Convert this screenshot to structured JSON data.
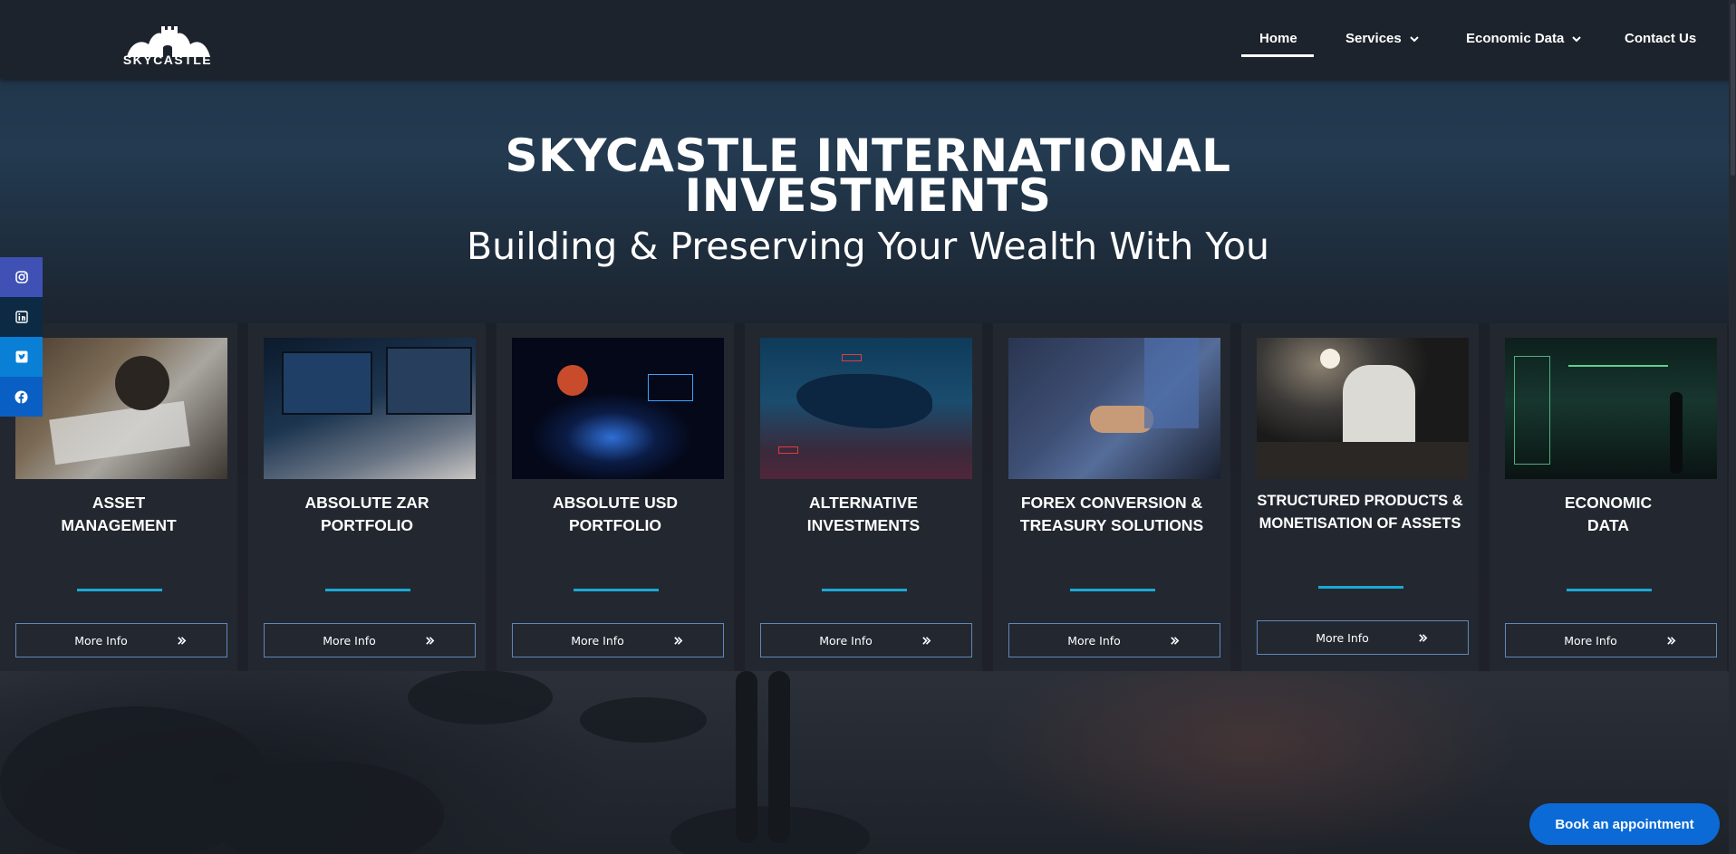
{
  "brand": {
    "name": "SKYCASTLE",
    "logo_icon": "castle-icon"
  },
  "nav": {
    "items": [
      {
        "label": "Home",
        "active": true,
        "has_dropdown": false
      },
      {
        "label": "Services",
        "active": false,
        "has_dropdown": true
      },
      {
        "label": "Economic Data",
        "active": false,
        "has_dropdown": true
      },
      {
        "label": "Contact Us",
        "active": false,
        "has_dropdown": false
      }
    ]
  },
  "hero": {
    "title": "SKYCASTLE INTERNATIONAL INVESTMENTS",
    "subtitle": "Building & Preserving Your Wealth With You"
  },
  "social": [
    {
      "icon": "instagram-icon",
      "color": "#3f51b5"
    },
    {
      "icon": "linkedin-icon",
      "color": "#0d2a44"
    },
    {
      "icon": "twitter-icon",
      "color": "#0a7fd6"
    },
    {
      "icon": "facebook-icon",
      "color": "#0a5fc4"
    }
  ],
  "cards": [
    {
      "title": "ASSET\nMANAGEMENT",
      "button": "More Info"
    },
    {
      "title": "ABSOLUTE ZAR\nPORTFOLIO",
      "button": "More Info"
    },
    {
      "title": "ABSOLUTE USD\nPORTFOLIO",
      "button": "More Info"
    },
    {
      "title": "ALTERNATIVE\nINVESTMENTS",
      "button": "More Info"
    },
    {
      "title": "FOREX CONVERSION &\nTREASURY SOLUTIONS",
      "button": "More Info"
    },
    {
      "title": "STRUCTURED PRODUCTS &\nMONETISATION OF ASSETS",
      "button": "More Info"
    },
    {
      "title": "ECONOMIC\nDATA",
      "button": "More Info"
    }
  ],
  "cta": {
    "label": "Book an appointment"
  },
  "colors": {
    "accent_line": "#1aa9d6",
    "button_border": "#5f87b8",
    "cta": "#0b6ad6"
  }
}
